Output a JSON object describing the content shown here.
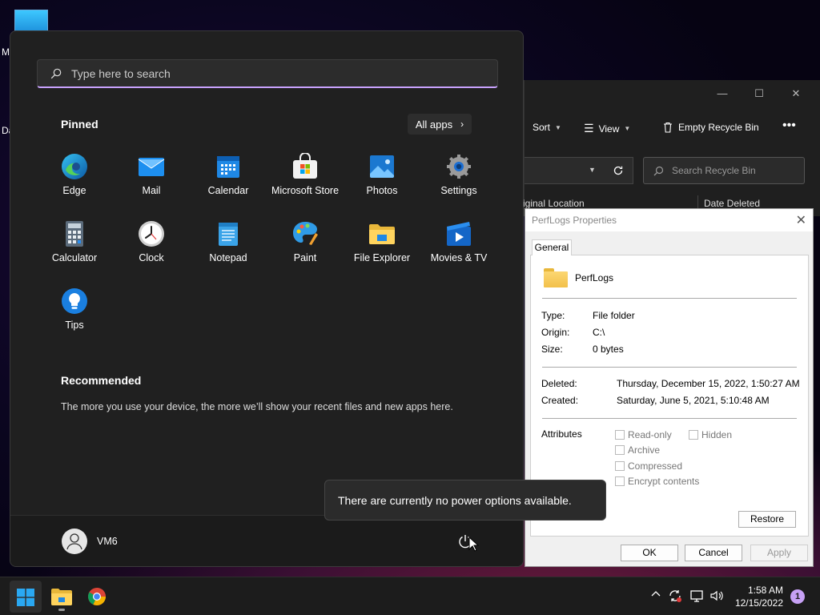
{
  "desktop": {
    "icon_label_1": "M",
    "icon_label_2": "Da"
  },
  "recycle_bin": {
    "toolbar": {
      "sort_label": "Sort",
      "view_label": "View",
      "empty_label": "Empty Recycle Bin"
    },
    "search_placeholder": "Search Recycle Bin",
    "columns": [
      "iginal Location",
      "Date Deleted"
    ]
  },
  "properties": {
    "title": "PerfLogs Properties",
    "tab": "General",
    "name": "PerfLogs",
    "type_label": "Type:",
    "type_value": "File folder",
    "origin_label": "Origin:",
    "origin_value": "C:\\",
    "size_label": "Size:",
    "size_value": "0 bytes",
    "deleted_label": "Deleted:",
    "deleted_value": "Thursday, December 15, 2022, 1:50:27 AM",
    "created_label": "Created:",
    "created_value": "Saturday, June 5, 2021, 5:10:48 AM",
    "attributes_label": "Attributes",
    "attributes": {
      "readonly": "Read-only",
      "hidden": "Hidden",
      "archive": "Archive",
      "compressed": "Compressed",
      "encrypt": "Encrypt contents"
    },
    "restore_label": "Restore",
    "ok_label": "OK",
    "cancel_label": "Cancel",
    "apply_label": "Apply"
  },
  "start_menu": {
    "search_placeholder": "Type here to search",
    "pinned_title": "Pinned",
    "all_apps_label": "All apps",
    "apps": [
      {
        "label": "Edge",
        "icon": "edge-icon"
      },
      {
        "label": "Mail",
        "icon": "mail-icon"
      },
      {
        "label": "Calendar",
        "icon": "calendar-icon"
      },
      {
        "label": "Microsoft Store",
        "icon": "store-icon"
      },
      {
        "label": "Photos",
        "icon": "photos-icon"
      },
      {
        "label": "Settings",
        "icon": "gear-icon"
      },
      {
        "label": "Calculator",
        "icon": "calculator-icon"
      },
      {
        "label": "Clock",
        "icon": "clock-icon"
      },
      {
        "label": "Notepad",
        "icon": "notepad-icon"
      },
      {
        "label": "Paint",
        "icon": "paint-icon"
      },
      {
        "label": "File Explorer",
        "icon": "folder-icon"
      },
      {
        "label": "Movies & TV",
        "icon": "movies-icon"
      },
      {
        "label": "Tips",
        "icon": "lightbulb-icon"
      }
    ],
    "recommended_title": "Recommended",
    "recommended_text": "The more you use your device, the more we’ll show your recent files and new apps here.",
    "username": "VM6"
  },
  "tooltip": {
    "text": "There are currently no power options available."
  },
  "taskbar": {
    "time": "1:58 AM",
    "date": "12/15/2022",
    "notification_count": "1"
  }
}
